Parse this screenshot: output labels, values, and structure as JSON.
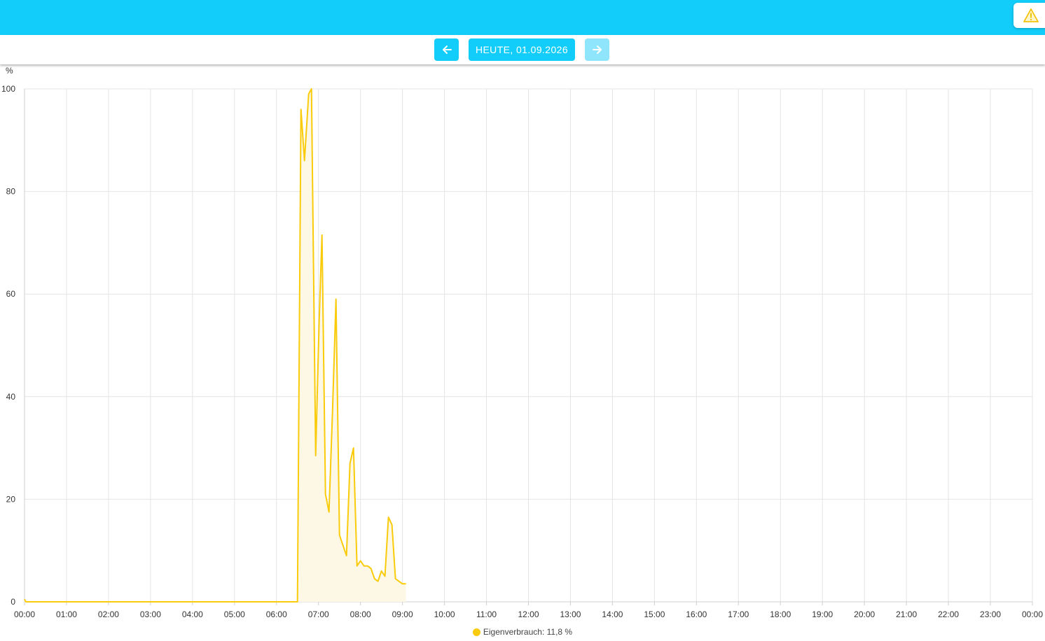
{
  "header": {
    "warning_icon": "warning-triangle-icon"
  },
  "nav": {
    "prev_icon": "arrow-left-icon",
    "next_icon": "arrow-right-icon",
    "date_label": "HEUTE, 01.09.2026"
  },
  "colors": {
    "header_bg": "#12cdf9",
    "series": "#f9cb0b",
    "series_fill": "#fdf8e6",
    "grid": "#e4e4e4",
    "warning": "#f4c20d"
  },
  "chart_data": {
    "type": "area",
    "ylabel": "%",
    "ylim": [
      0,
      100
    ],
    "yticks": [
      0,
      20,
      40,
      60,
      80,
      100
    ],
    "xlim": [
      "00:00",
      "24:00"
    ],
    "xticks": [
      "00:00",
      "01:00",
      "02:00",
      "03:00",
      "04:00",
      "05:00",
      "06:00",
      "07:00",
      "08:00",
      "09:00",
      "10:00",
      "11:00",
      "12:00",
      "13:00",
      "14:00",
      "15:00",
      "16:00",
      "17:00",
      "18:00",
      "19:00",
      "20:00",
      "21:00",
      "22:00",
      "23:00",
      "00:00"
    ],
    "grid": true,
    "legend_position": "bottom-center",
    "series": [
      {
        "name": "Eigenverbrauch: 11,8 %",
        "points": [
          [
            "00:00",
            0.5
          ],
          [
            "00:02",
            0
          ],
          [
            "06:30",
            0
          ],
          [
            "06:35",
            96
          ],
          [
            "06:40",
            86
          ],
          [
            "06:46",
            99
          ],
          [
            "06:50",
            100
          ],
          [
            "06:56",
            28.5
          ],
          [
            "07:01",
            55
          ],
          [
            "07:05",
            71.5
          ],
          [
            "07:10",
            21
          ],
          [
            "07:15",
            17.5
          ],
          [
            "07:20",
            37
          ],
          [
            "07:25",
            59
          ],
          [
            "07:30",
            13
          ],
          [
            "07:35",
            11
          ],
          [
            "07:40",
            9
          ],
          [
            "07:45",
            27
          ],
          [
            "07:50",
            30
          ],
          [
            "07:55",
            7
          ],
          [
            "08:00",
            8
          ],
          [
            "08:05",
            7
          ],
          [
            "08:10",
            7
          ],
          [
            "08:15",
            6.5
          ],
          [
            "08:20",
            4.5
          ],
          [
            "08:25",
            4
          ],
          [
            "08:30",
            6
          ],
          [
            "08:35",
            5
          ],
          [
            "08:40",
            16.5
          ],
          [
            "08:45",
            15
          ],
          [
            "08:50",
            4.5
          ],
          [
            "08:55",
            4
          ],
          [
            "09:00",
            3.5
          ],
          [
            "09:05",
            3.5
          ]
        ]
      }
    ]
  }
}
